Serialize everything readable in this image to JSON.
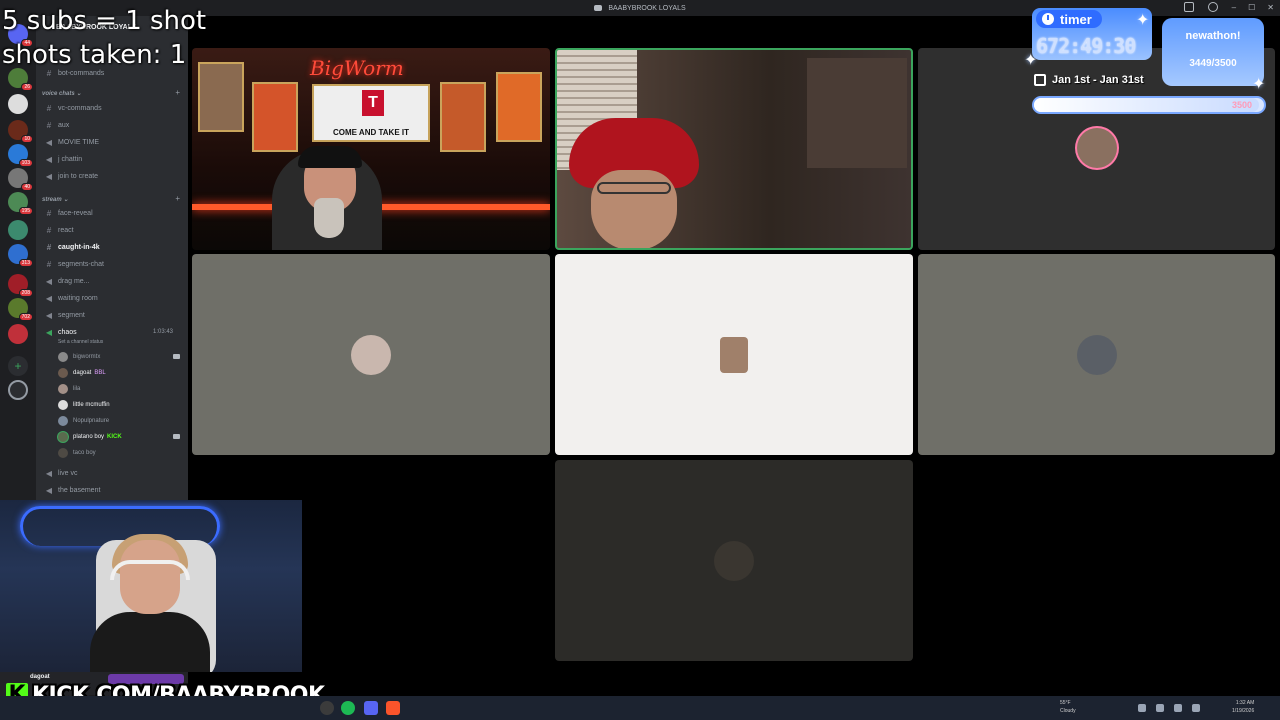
{
  "window": {
    "title": "BAABYBROOK LOYALS",
    "controls": [
      "–",
      "☐",
      "✕"
    ]
  },
  "overlay": {
    "line1": "5 subs = 1 shot",
    "line2": "shots taken: 1"
  },
  "server": {
    "name": "BAABYBROOK LOYALS"
  },
  "rail_badges": [
    "44",
    "26",
    "10",
    "103",
    "40",
    "195",
    "313",
    "208",
    "702"
  ],
  "channels": {
    "top": [
      {
        "name": "bot-commands",
        "type": "text"
      }
    ],
    "category_voice": "voice chats",
    "voice": [
      {
        "name": "vc-commands",
        "type": "text"
      },
      {
        "name": "aux",
        "type": "text"
      },
      {
        "name": "MOVIE TIME",
        "type": "voice"
      },
      {
        "name": "j chattin",
        "type": "voice"
      },
      {
        "name": "join to create",
        "type": "voice"
      }
    ],
    "category_stream": "stream",
    "stream": [
      {
        "name": "face-reveal",
        "type": "text"
      },
      {
        "name": "react",
        "type": "text"
      },
      {
        "name": "caught-in-4k",
        "type": "text",
        "bold": true
      },
      {
        "name": "segments-chat",
        "type": "text"
      },
      {
        "name": "drag me...",
        "type": "voice"
      },
      {
        "name": "waiting room",
        "type": "voice"
      },
      {
        "name": "segment",
        "type": "voice"
      }
    ],
    "active": {
      "name": "chaos",
      "duration": "1:03:43",
      "status": "Set a channel status"
    },
    "members": [
      {
        "name": "bigwormtx",
        "tag": "",
        "video": true,
        "color": "#8a8a8a"
      },
      {
        "name": "dagoat",
        "tag": "BBL",
        "video": false,
        "color": "#6b5a4e"
      },
      {
        "name": "lila",
        "tag": "",
        "video": false,
        "color": "#a39088"
      },
      {
        "name": "little mcmuffin",
        "tag": "",
        "video": false,
        "color": "#ddd"
      },
      {
        "name": "Nopulpnature",
        "tag": "",
        "video": false,
        "color": "#7c8a9c"
      },
      {
        "name": "platano boy",
        "tag": "KICK",
        "video": true,
        "color": "#5a6b4e"
      },
      {
        "name": "taco boy",
        "tag": "",
        "video": false,
        "color": "#4e4a44"
      }
    ],
    "after": [
      {
        "name": "live vc",
        "type": "voice"
      },
      {
        "name": "the basement",
        "type": "voice"
      }
    ]
  },
  "user": {
    "name": "dagoat"
  },
  "kick_banner": {
    "letter": "K",
    "url": "KICK.COM/BAABYBROOK"
  },
  "bigworm": {
    "neon": "BigWorm",
    "flag_letter": "T",
    "flag_text": "COME AND TAKE IT"
  },
  "timer": {
    "label": "timer",
    "value": "672:49:30",
    "event": "newathon!",
    "subs": "3449/3500",
    "date_range": "Jan 1st - Jan 31st",
    "goal_value": "3500",
    "goal_progress": 0.98
  },
  "taskbar": {
    "weather_temp": "55°F",
    "weather_desc": "Cloudy",
    "time": "1:32 AM",
    "date": "1/19/2026"
  },
  "colors": {
    "kick_green": "#53fc18",
    "speaking": "#3ba55d",
    "discord_bg": "#2b2d31"
  }
}
